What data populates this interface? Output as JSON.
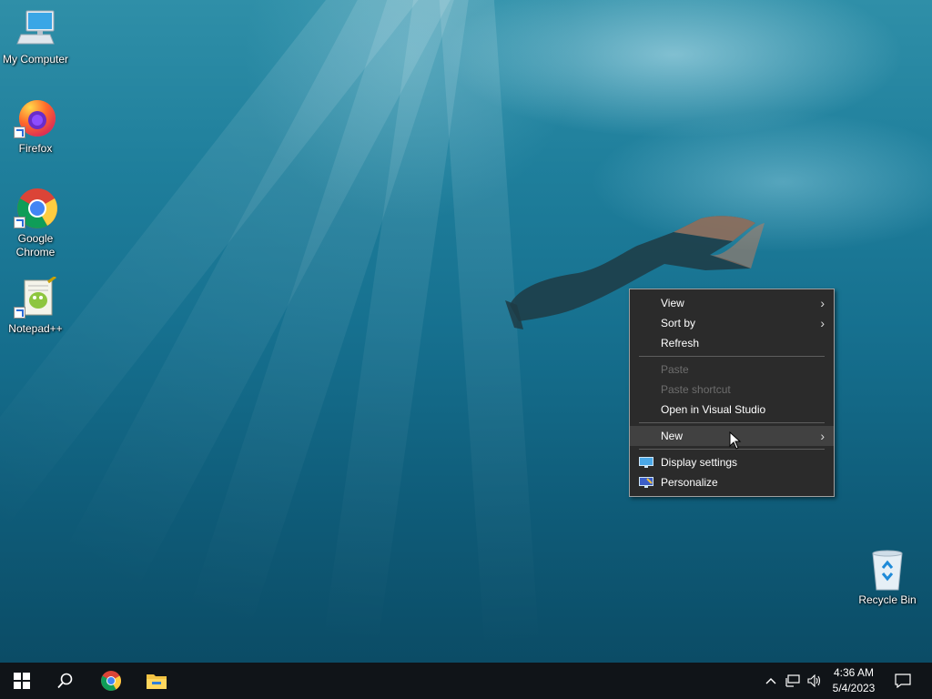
{
  "desktop": {
    "icons": [
      {
        "label": "My Computer",
        "icon": "computer-icon"
      },
      {
        "label": "Firefox",
        "icon": "firefox-icon"
      },
      {
        "label": "Google Chrome",
        "icon": "chrome-icon"
      },
      {
        "label": "Notepad++",
        "icon": "notepadpp-icon"
      },
      {
        "label": "Recycle Bin",
        "icon": "recycle-bin-icon"
      }
    ]
  },
  "context_menu": {
    "items": [
      {
        "label": "View",
        "submenu": true
      },
      {
        "label": "Sort by",
        "submenu": true
      },
      {
        "label": "Refresh"
      },
      {
        "label": "Paste",
        "disabled": true
      },
      {
        "label": "Paste shortcut",
        "disabled": true
      },
      {
        "label": "Open in Visual Studio"
      },
      {
        "label": "New",
        "submenu": true,
        "highlighted": true
      },
      {
        "label": "Display settings",
        "icon": "display-icon"
      },
      {
        "label": "Personalize",
        "icon": "personalize-icon"
      }
    ]
  },
  "taskbar": {
    "pinned": [
      "start-icon",
      "search-icon",
      "chrome-icon",
      "file-explorer-icon"
    ],
    "tray": [
      "chevron-up-icon",
      "network-icon",
      "volume-icon",
      "notification-icon"
    ],
    "time": "4:36 AM",
    "date": "5/4/2023"
  },
  "colors": {
    "menu_bg": "#2b2b2b",
    "menu_hover": "#414141",
    "taskbar_bg": "#101418"
  }
}
